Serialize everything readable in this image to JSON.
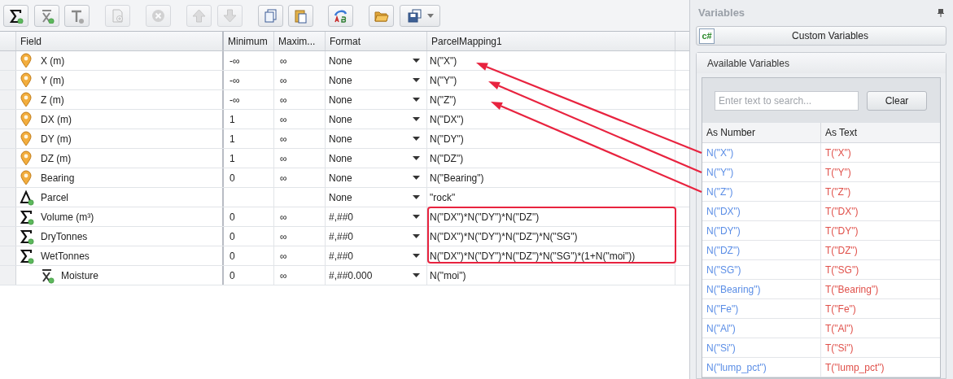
{
  "toolbar": [
    {
      "kind": "sigma",
      "disabled": false
    },
    {
      "kind": "xbar",
      "disabled": false
    },
    {
      "kind": "text",
      "disabled": false
    },
    {
      "kind": "add",
      "disabled": true
    },
    {
      "kind": "delete",
      "disabled": true
    },
    {
      "kind": "up",
      "disabled": true
    },
    {
      "kind": "down",
      "disabled": true
    },
    {
      "kind": "copy",
      "disabled": false
    },
    {
      "kind": "paste",
      "disabled": false
    },
    {
      "kind": "rename",
      "disabled": false
    },
    {
      "kind": "open",
      "disabled": false
    },
    {
      "kind": "save",
      "disabled": false
    }
  ],
  "grid": {
    "columns": [
      "Field",
      "Minimum",
      "Maxim...",
      "Format",
      "ParcelMapping1"
    ],
    "rows": [
      {
        "kind": "pin",
        "field": "X (m)",
        "minimum": "-∞",
        "maximum": "∞",
        "format": "None",
        "mapping": "N(\"X\")"
      },
      {
        "kind": "pin",
        "field": "Y (m)",
        "minimum": "-∞",
        "maximum": "∞",
        "format": "None",
        "mapping": "N(\"Y\")"
      },
      {
        "kind": "pin",
        "field": "Z (m)",
        "minimum": "-∞",
        "maximum": "∞",
        "format": "None",
        "mapping": "N(\"Z\")"
      },
      {
        "kind": "pin",
        "field": "DX (m)",
        "minimum": "1",
        "maximum": "∞",
        "format": "None",
        "mapping": "N(\"DX\")"
      },
      {
        "kind": "pin",
        "field": "DY (m)",
        "minimum": "1",
        "maximum": "∞",
        "format": "None",
        "mapping": "N(\"DY\")"
      },
      {
        "kind": "pin",
        "field": "DZ (m)",
        "minimum": "1",
        "maximum": "∞",
        "format": "None",
        "mapping": "N(\"DZ\")"
      },
      {
        "kind": "pin",
        "field": "Bearing",
        "minimum": "0",
        "maximum": "∞",
        "format": "None",
        "mapping": "N(\"Bearing\")"
      },
      {
        "kind": "delta",
        "field": "Parcel",
        "format": "None",
        "mapping": "\"rock\""
      },
      {
        "kind": "sigma",
        "field": "Volume (m³)",
        "minimum": "0",
        "maximum": "∞",
        "format": "#,##0",
        "mapping": "N(\"DX\")*N(\"DY\")*N(\"DZ\")"
      },
      {
        "kind": "sigma",
        "field": "DryTonnes",
        "minimum": "0",
        "maximum": "∞",
        "format": "#,##0",
        "mapping": "N(\"DX\")*N(\"DY\")*N(\"DZ\")*N(\"SG\")"
      },
      {
        "kind": "sigma",
        "field": "WetTonnes",
        "minimum": "0",
        "maximum": "∞",
        "format": "#,##0",
        "mapping": "N(\"DX\")*N(\"DY\")*N(\"DZ\")*N(\"SG\")*(1+N(\"moi\"))",
        "children": [
          {
            "kind": "xbar",
            "field": "Moisture",
            "minimum": "0",
            "maximum": "∞",
            "format": "#,##0.000",
            "mapping": "N(\"moi\")"
          }
        ]
      }
    ]
  },
  "variables_panel": {
    "title": "Variables",
    "custom_button": {
      "icon_text": "c#",
      "label": "Custom Variables"
    },
    "available": {
      "title": "Available Variables",
      "search": {
        "placeholder": "Enter text to search..."
      },
      "clear_button": "Clear",
      "columns": [
        "As Number",
        "As Text"
      ],
      "rows": [
        {
          "number": "N(\"X\")",
          "text": "T(\"X\")"
        },
        {
          "number": "N(\"Y\")",
          "text": "T(\"Y\")"
        },
        {
          "number": "N(\"Z\")",
          "text": "T(\"Z\")"
        },
        {
          "number": "N(\"DX\")",
          "text": "T(\"DX\")"
        },
        {
          "number": "N(\"DY\")",
          "text": "T(\"DY\")"
        },
        {
          "number": "N(\"DZ\")",
          "text": "T(\"DZ\")"
        },
        {
          "number": "N(\"SG\")",
          "text": "T(\"SG\")"
        },
        {
          "number": "N(\"Bearing\")",
          "text": "T(\"Bearing\")"
        },
        {
          "number": "N(\"Fe\")",
          "text": "T(\"Fe\")"
        },
        {
          "number": "N(\"Al\")",
          "text": "T(\"Al\")"
        },
        {
          "number": "N(\"Si\")",
          "text": "T(\"Si\")"
        },
        {
          "number": "N(\"lump_pct\")",
          "text": "T(\"lump_pct\")"
        }
      ]
    }
  }
}
